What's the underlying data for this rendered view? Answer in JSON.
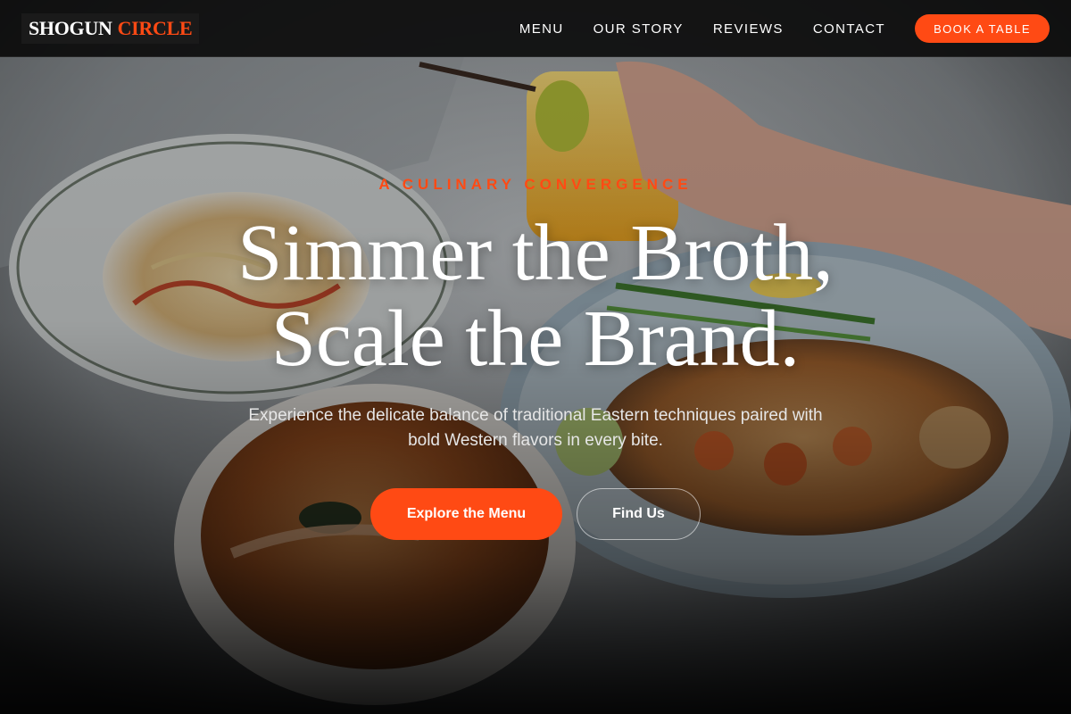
{
  "brand": {
    "name_white": "SHOGUN",
    "name_accent": "CIRCLE"
  },
  "nav": {
    "items": [
      {
        "label": "MENU"
      },
      {
        "label": "OUR STORY"
      },
      {
        "label": "REVIEWS"
      },
      {
        "label": "CONTACT"
      }
    ],
    "cta_label": "BOOK A TABLE"
  },
  "hero": {
    "eyebrow": "A CULINARY CONVERGENCE",
    "headline_line1": "Simmer the Broth,",
    "headline_line2": "Scale the Brand.",
    "subtitle": "Experience the delicate balance of traditional Eastern techniques paired with bold Western flavors in every bite.",
    "primary_cta": "Explore the Menu",
    "secondary_cta": "Find Us"
  },
  "colors": {
    "accent": "#ff4a14",
    "header_bg": "#0c0c0c",
    "text": "#ffffff"
  }
}
